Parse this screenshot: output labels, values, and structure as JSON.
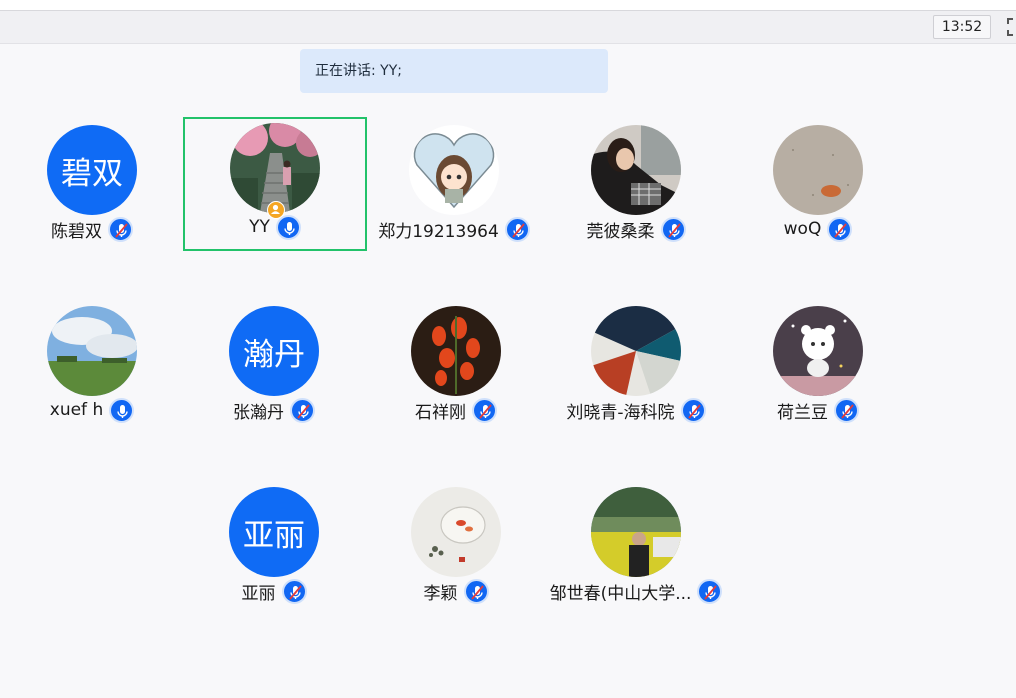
{
  "clock": "13:52",
  "speaking_banner": "正在讲话: YY;",
  "participants": [
    {
      "name": "陈碧双",
      "avatar_text": "碧双",
      "muted": true,
      "avatar": "text-avatar"
    },
    {
      "name": "YY",
      "muted": false,
      "host": true,
      "active": true,
      "avatar": "stairs-photo"
    },
    {
      "name": "郑力19213964",
      "muted": true,
      "avatar": "cartoon-heart"
    },
    {
      "name": "莞彼桑柔",
      "muted": true,
      "avatar": "car-photo"
    },
    {
      "name": "woQ",
      "muted": true,
      "avatar": "sand-shell"
    },
    {
      "name": "xuef h",
      "muted": false,
      "avatar": "landscape-photo"
    },
    {
      "name": "张瀚丹",
      "avatar_text": "瀚丹",
      "muted": true,
      "avatar": "text-avatar"
    },
    {
      "name": "石祥刚",
      "muted": true,
      "avatar": "flowers-photo"
    },
    {
      "name": "刘晓青-海科院",
      "muted": true,
      "avatar": "abstract-art"
    },
    {
      "name": "荷兰豆",
      "muted": true,
      "avatar": "cartoon-astronaut"
    },
    {
      "name": "亚丽",
      "avatar_text": "亚丽",
      "muted": true,
      "avatar": "text-avatar"
    },
    {
      "name": "李颖",
      "muted": true,
      "avatar": "fish-bowl"
    },
    {
      "name": "邹世春(中山大学...",
      "muted": true,
      "avatar": "grassland-photo"
    }
  ],
  "colors": {
    "accent": "#1167f3",
    "active_border": "#22c26a",
    "banner": "#dce9fb",
    "host_badge": "#f5a623"
  }
}
